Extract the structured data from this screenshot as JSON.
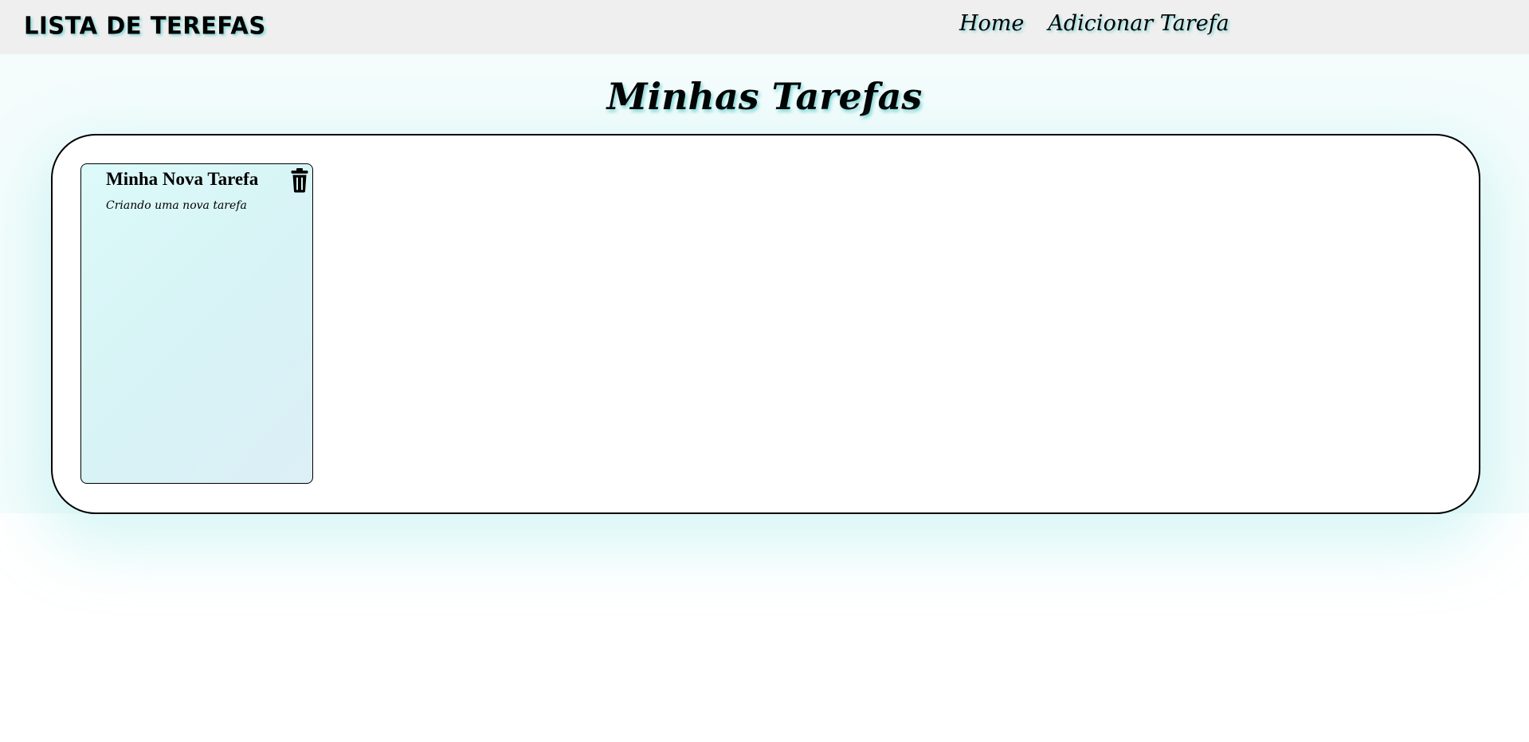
{
  "navbar": {
    "brand": "LISTA DE TEREFAS",
    "links": [
      {
        "label": "Home"
      },
      {
        "label": "Adicionar Tarefa"
      }
    ]
  },
  "main": {
    "title": "Minhas Tarefas",
    "tasks": [
      {
        "title": "Minha Nova Tarefa",
        "description": "Criando uma nova tarefa",
        "delete_icon": "trash-icon"
      }
    ]
  },
  "colors": {
    "navbar_bg": "#efefef",
    "text_shadow_accent": "#6ed2d2",
    "card_bg": "#d7f3f5"
  }
}
